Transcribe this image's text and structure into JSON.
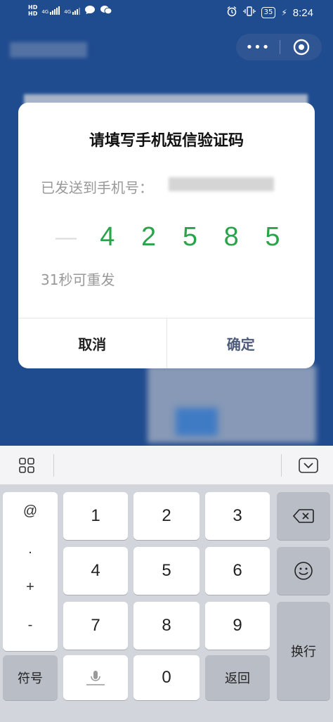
{
  "status_bar": {
    "left_hd1": "HD",
    "left_hd2": "HD",
    "net1": "4G",
    "net2": "4G",
    "battery": "35",
    "time": "8:24"
  },
  "capsule": {
    "more_label": "•••"
  },
  "dialog": {
    "title": "请填写手机短信验证码",
    "sent_to_label": "已发送到手机号：",
    "code_digits": [
      "",
      "4",
      "2",
      "5",
      "8",
      "5"
    ],
    "resend_text": "31秒可重发",
    "cancel_label": "取消",
    "confirm_label": "确定"
  },
  "keyboard": {
    "symbols": [
      "@",
      ".",
      "+",
      "-"
    ],
    "row1": [
      "1",
      "2",
      "3"
    ],
    "row2": [
      "4",
      "5",
      "6"
    ],
    "row3": [
      "7",
      "8",
      "9"
    ],
    "fuhao_label": "符号",
    "zero_label": "0",
    "back_label": "返回",
    "enter_label": "换行"
  },
  "colors": {
    "accent_green": "#2aa44a",
    "background_blue": "#1f4b8f"
  }
}
